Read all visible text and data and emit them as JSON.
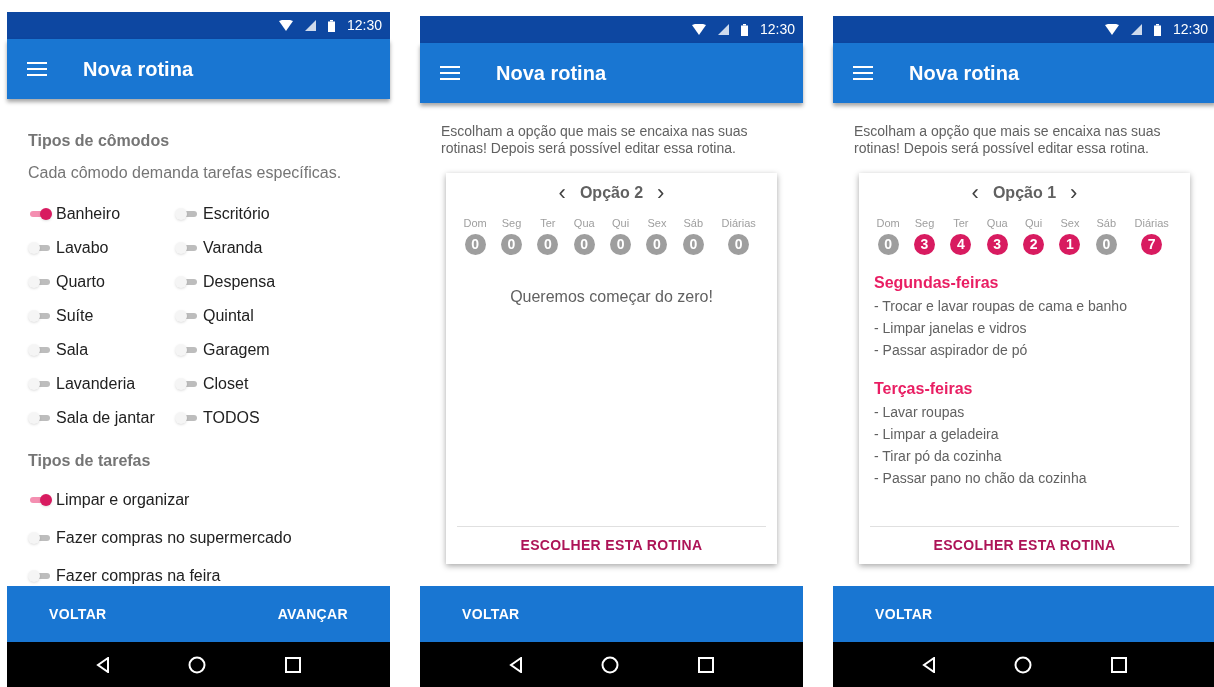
{
  "screens": [
    {
      "kind": "rooms",
      "status_time": "12:30",
      "title": "Nova rotina",
      "room_section": {
        "heading": "Tipos de cômodos",
        "description": "Cada cômodo demanda tarefas específicas.",
        "toggles": [
          {
            "label": "Banheiro",
            "on": true
          },
          {
            "label": "Escritório",
            "on": false
          },
          {
            "label": "Lavabo",
            "on": false
          },
          {
            "label": "Varanda",
            "on": false
          },
          {
            "label": "Quarto",
            "on": false
          },
          {
            "label": "Despensa",
            "on": false
          },
          {
            "label": "Suíte",
            "on": false
          },
          {
            "label": "Quintal",
            "on": false
          },
          {
            "label": "Sala",
            "on": false
          },
          {
            "label": "Garagem",
            "on": false
          },
          {
            "label": "Lavanderia",
            "on": false
          },
          {
            "label": "Closet",
            "on": false
          },
          {
            "label": "Sala de jantar",
            "on": false
          },
          {
            "label": "TODOS",
            "on": false
          }
        ]
      },
      "task_section": {
        "heading": "Tipos de tarefas",
        "toggles": [
          {
            "label": "Limpar e organizar",
            "on": true
          },
          {
            "label": "Fazer compras no supermercado",
            "on": false
          },
          {
            "label": "Fazer compras na feira",
            "on": false
          }
        ]
      },
      "buttons": [
        "VOLTAR",
        "AVANÇAR"
      ]
    },
    {
      "kind": "options",
      "status_time": "12:30",
      "title": "Nova rotina",
      "intro": "Escolham a opção que mais se encaixa nas suas rotinas! Depois será possível editar essa rotina.",
      "card": {
        "option": "Opção 2",
        "prev": "‹",
        "next": "›",
        "days": [
          {
            "label": "Dom",
            "count": "0",
            "color": "#9e9e9e"
          },
          {
            "label": "Seg",
            "count": "0",
            "color": "#9e9e9e"
          },
          {
            "label": "Ter",
            "count": "0",
            "color": "#9e9e9e"
          },
          {
            "label": "Qua",
            "count": "0",
            "color": "#9e9e9e"
          },
          {
            "label": "Qui",
            "count": "0",
            "color": "#9e9e9e"
          },
          {
            "label": "Sex",
            "count": "0",
            "color": "#9e9e9e"
          },
          {
            "label": "Sáb",
            "count": "0",
            "color": "#9e9e9e"
          },
          {
            "label": "Diárias",
            "count": "0",
            "color": "#9e9e9e"
          }
        ],
        "message": "Queremos começar do zero!",
        "action": "ESCOLHER ESTA ROTINA"
      },
      "buttons": [
        "VOLTAR"
      ]
    },
    {
      "kind": "options",
      "status_time": "12:30",
      "title": "Nova rotina",
      "intro": "Escolham a opção que mais se encaixa nas suas rotinas! Depois será possível editar essa rotina.",
      "card": {
        "option": "Opção 1",
        "prev": "‹",
        "next": "›",
        "days": [
          {
            "label": "Dom",
            "count": "0",
            "color": "#9e9e9e"
          },
          {
            "label": "Seg",
            "count": "3",
            "color": "#d81b60"
          },
          {
            "label": "Ter",
            "count": "4",
            "color": "#d81b60"
          },
          {
            "label": "Qua",
            "count": "3",
            "color": "#d81b60"
          },
          {
            "label": "Qui",
            "count": "2",
            "color": "#d81b60"
          },
          {
            "label": "Sex",
            "count": "1",
            "color": "#d81b60"
          },
          {
            "label": "Sáb",
            "count": "0",
            "color": "#9e9e9e"
          },
          {
            "label": "Diárias",
            "count": "7",
            "color": "#d81b60"
          }
        ],
        "schedule": [
          {
            "heading": "Segundas-feiras",
            "tasks": [
              "- Trocar e lavar roupas de cama e banho",
              "- Limpar janelas e vidros",
              "- Passar aspirador de pó"
            ]
          },
          {
            "heading": "Terças-feiras",
            "tasks": [
              "- Lavar roupas",
              "- Limpar a geladeira",
              "- Tirar pó da cozinha",
              "- Passar pano no chão da cozinha"
            ]
          }
        ],
        "action": "ESCOLHER ESTA ROTINA"
      },
      "buttons": [
        "VOLTAR"
      ]
    }
  ]
}
